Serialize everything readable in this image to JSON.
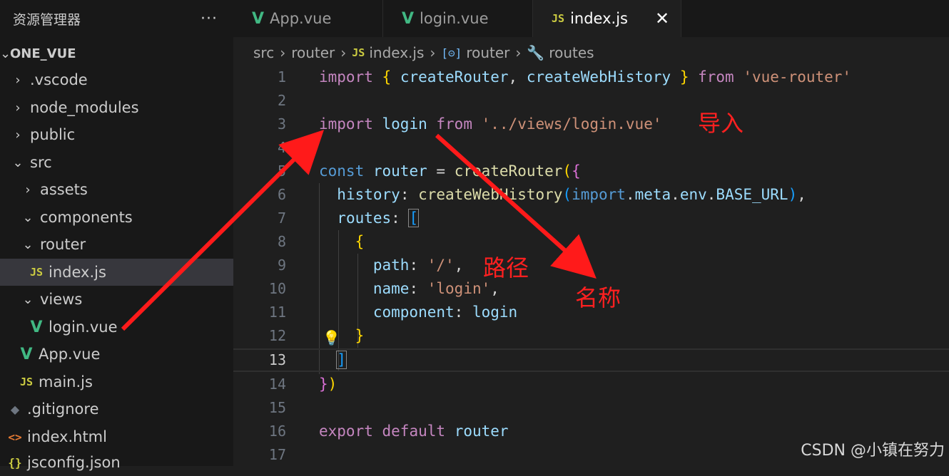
{
  "sidebar": {
    "title": "资源管理器",
    "more_label": "···",
    "root": "ONE_VUE",
    "items": [
      {
        "label": ".vscode",
        "chev": "›",
        "icon": ""
      },
      {
        "label": "node_modules",
        "chev": "›",
        "icon": ""
      },
      {
        "label": "public",
        "chev": "›",
        "icon": ""
      },
      {
        "label": "src",
        "chev": "⌄",
        "icon": ""
      },
      {
        "label": "assets",
        "chev": "›",
        "icon": ""
      },
      {
        "label": "components",
        "chev": "⌄",
        "icon": ""
      },
      {
        "label": "router",
        "chev": "⌄",
        "icon": ""
      },
      {
        "label": "index.js",
        "chev": "",
        "icon": "JS"
      },
      {
        "label": "views",
        "chev": "⌄",
        "icon": ""
      },
      {
        "label": "login.vue",
        "chev": "",
        "icon": "V"
      },
      {
        "label": "App.vue",
        "chev": "",
        "icon": "V"
      },
      {
        "label": "main.js",
        "chev": "",
        "icon": "JS"
      },
      {
        "label": ".gitignore",
        "chev": "",
        "icon": "◆"
      },
      {
        "label": "index.html",
        "chev": "",
        "icon": "<>"
      },
      {
        "label": "jsconfig.json",
        "chev": "",
        "icon": "{}"
      }
    ]
  },
  "tabs": [
    {
      "label": "App.vue",
      "icon": "V"
    },
    {
      "label": "login.vue",
      "icon": "V"
    },
    {
      "label": "index.js",
      "icon": "JS",
      "close": "✕"
    }
  ],
  "breadcrumb": {
    "parts": [
      "src",
      "router",
      "index.js",
      "router",
      "routes"
    ],
    "sep": "›",
    "js_icon": "JS",
    "ns_icon": "[⊝]",
    "wrench_icon": "🔧"
  },
  "editor": {
    "line_numbers": [
      "1",
      "2",
      "3",
      "4",
      "5",
      "6",
      "7",
      "8",
      "9",
      "10",
      "11",
      "12",
      "13",
      "14",
      "15",
      "16",
      "17"
    ],
    "current_line": 13
  },
  "annotations": {
    "import_note": "导入",
    "path_note": "路径",
    "name_note": "名称",
    "arrow_color": "#ff1a1a"
  },
  "watermark": "CSDN @小镇在努力",
  "colors": {
    "vue": "#41b883",
    "js": "#cbcb41",
    "keyword": "#569cd6",
    "string": "#ce9178"
  }
}
